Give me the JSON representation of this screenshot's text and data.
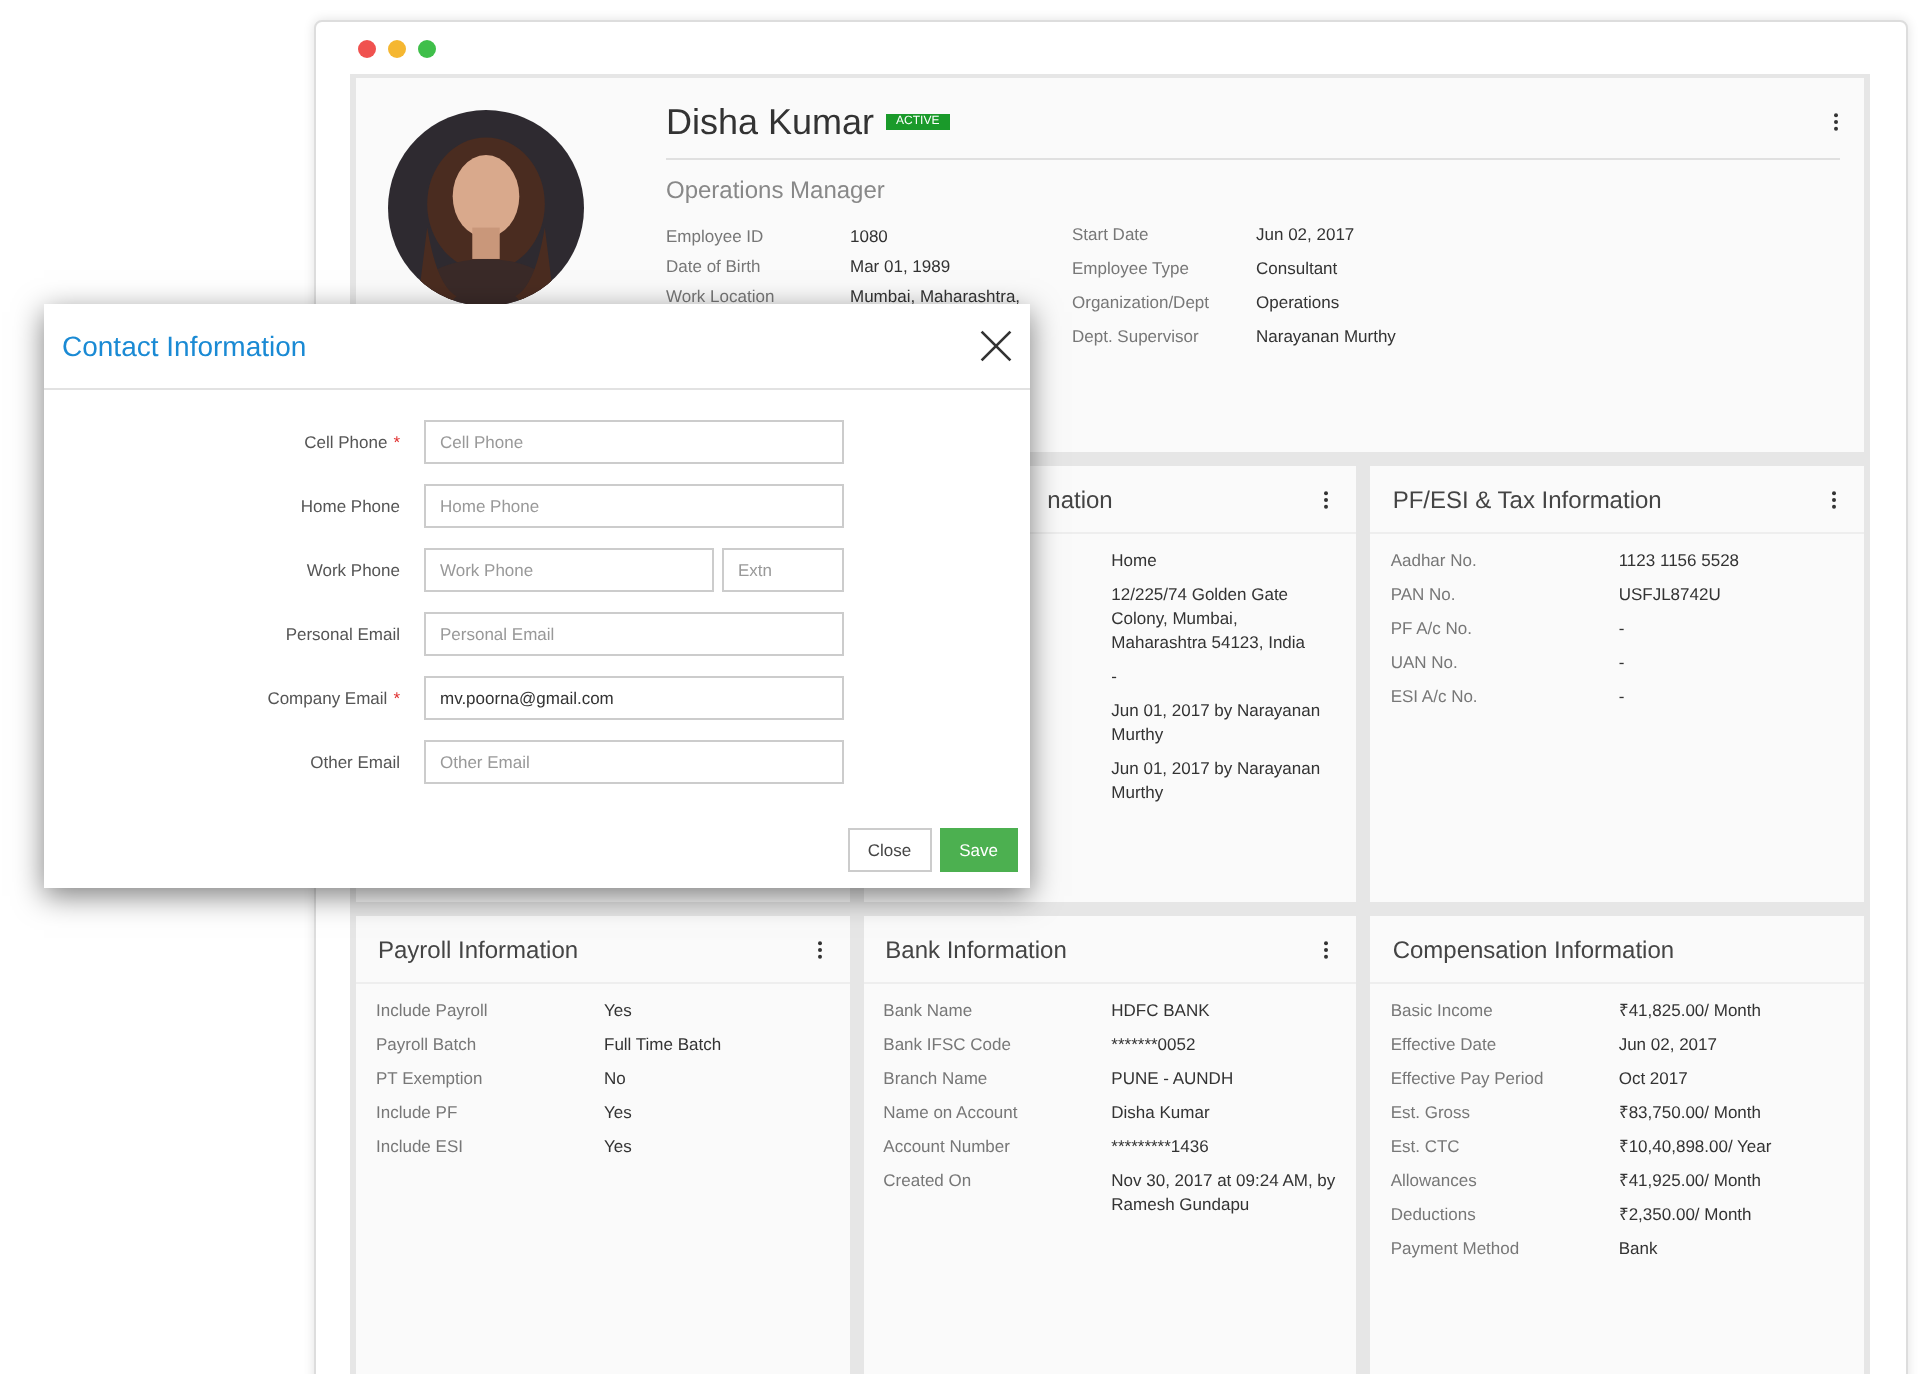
{
  "window": {
    "dots": [
      {
        "color": "#f0524f"
      },
      {
        "color": "#f5b731"
      },
      {
        "color": "#3fbf4a"
      }
    ]
  },
  "profile": {
    "name": "Disha Kumar",
    "status": "ACTIVE",
    "title": "Operations Manager",
    "fields_left": [
      {
        "label": "Employee ID",
        "value": "1080"
      },
      {
        "label": "Date of Birth",
        "value": "Mar 01, 1989"
      },
      {
        "label": "Work Location",
        "value": "Mumbai, Maharashtra,"
      }
    ],
    "fields_right": [
      {
        "label": "Start Date",
        "value": "Jun 02, 2017"
      },
      {
        "label": "Employee Type",
        "value": "Consultant"
      },
      {
        "label": "Organization/Dept",
        "value": "Operations"
      },
      {
        "label": "Dept. Supervisor",
        "value": "Narayanan Murthy"
      }
    ]
  },
  "cards": [
    {
      "title": "nation",
      "covered": true,
      "menu": true,
      "rows": [
        {
          "value": "Home"
        },
        {
          "value": "12/225/74 Golden Gate Colony, Mumbai, Maharashtra 54123, India"
        },
        {
          "value": "-"
        },
        {
          "value": "Jun 01, 2017 by Narayanan Murthy"
        },
        {
          "value": "Jun 01, 2017 by Narayanan Murthy"
        }
      ]
    },
    {
      "title": "PF/ESI & Tax Information",
      "covered": false,
      "menu": true,
      "rows": [
        {
          "label": "Aadhar No.",
          "value": "1123 1156 5528"
        },
        {
          "label": "PAN No.",
          "value": "USFJL8742U"
        },
        {
          "label": "PF A/c No.",
          "value": "-"
        },
        {
          "label": "UAN No.",
          "value": "-"
        },
        {
          "label": "ESI A/c No.",
          "value": "-"
        }
      ]
    },
    {
      "title": "Payroll Information",
      "covered": false,
      "menu": true,
      "rows": [
        {
          "label": "Include Payroll",
          "value": "Yes"
        },
        {
          "label": "Payroll Batch",
          "value": "Full Time Batch"
        },
        {
          "label": "PT Exemption",
          "value": "No"
        },
        {
          "label": "Include PF",
          "value": "Yes"
        },
        {
          "label": "Include ESI",
          "value": "Yes"
        }
      ]
    },
    {
      "title": "Bank Information",
      "covered": false,
      "menu": true,
      "rows": [
        {
          "label": "Bank Name",
          "value": "HDFC BANK"
        },
        {
          "label": "Bank IFSC Code",
          "value": "*******0052"
        },
        {
          "label": "Branch Name",
          "value": "PUNE - AUNDH"
        },
        {
          "label": "Name on Account",
          "value": "Disha Kumar"
        },
        {
          "label": "Account Number",
          "value": "*********1436"
        },
        {
          "label": "Created On",
          "value": "Nov 30, 2017 at 09:24 AM, by Ramesh Gundapu"
        }
      ]
    },
    {
      "title": "Compensation Information",
      "covered": false,
      "menu": false,
      "rows": [
        {
          "label": "Basic Income",
          "value": "₹41,825.00/ Month"
        },
        {
          "label": "Effective Date",
          "value": "Jun 02, 2017"
        },
        {
          "label": "Effective Pay Period",
          "value": "Oct 2017"
        },
        {
          "label": "Est. Gross",
          "value": "₹83,750.00/ Month"
        },
        {
          "label": "Est. CTC",
          "value": "₹10,40,898.00/ Year"
        },
        {
          "label": "Allowances",
          "value": "₹41,925.00/ Month"
        },
        {
          "label": "Deductions",
          "value": "₹2,350.00/ Month"
        },
        {
          "label": "Payment Method",
          "value": "Bank"
        }
      ]
    }
  ],
  "dialog": {
    "title": "Contact Information",
    "fields": [
      {
        "label": "Cell Phone",
        "required_mark": "*",
        "placeholder": "Cell Phone"
      },
      {
        "label": "Home Phone",
        "placeholder": "Home Phone"
      },
      {
        "label": "Work Phone",
        "placeholder": "Work Phone",
        "extension": {
          "placeholder": "Extn"
        }
      },
      {
        "label": "Personal Email",
        "placeholder": "Personal Email"
      },
      {
        "label": "Company Email",
        "required_mark": "*",
        "value": "mv.poorna@gmail.com"
      },
      {
        "label": "Other Email",
        "placeholder": "Other Email"
      }
    ],
    "buttons": [
      {
        "label": "Close",
        "kind": "secondary"
      },
      {
        "label": "Save",
        "kind": "primary"
      }
    ]
  }
}
